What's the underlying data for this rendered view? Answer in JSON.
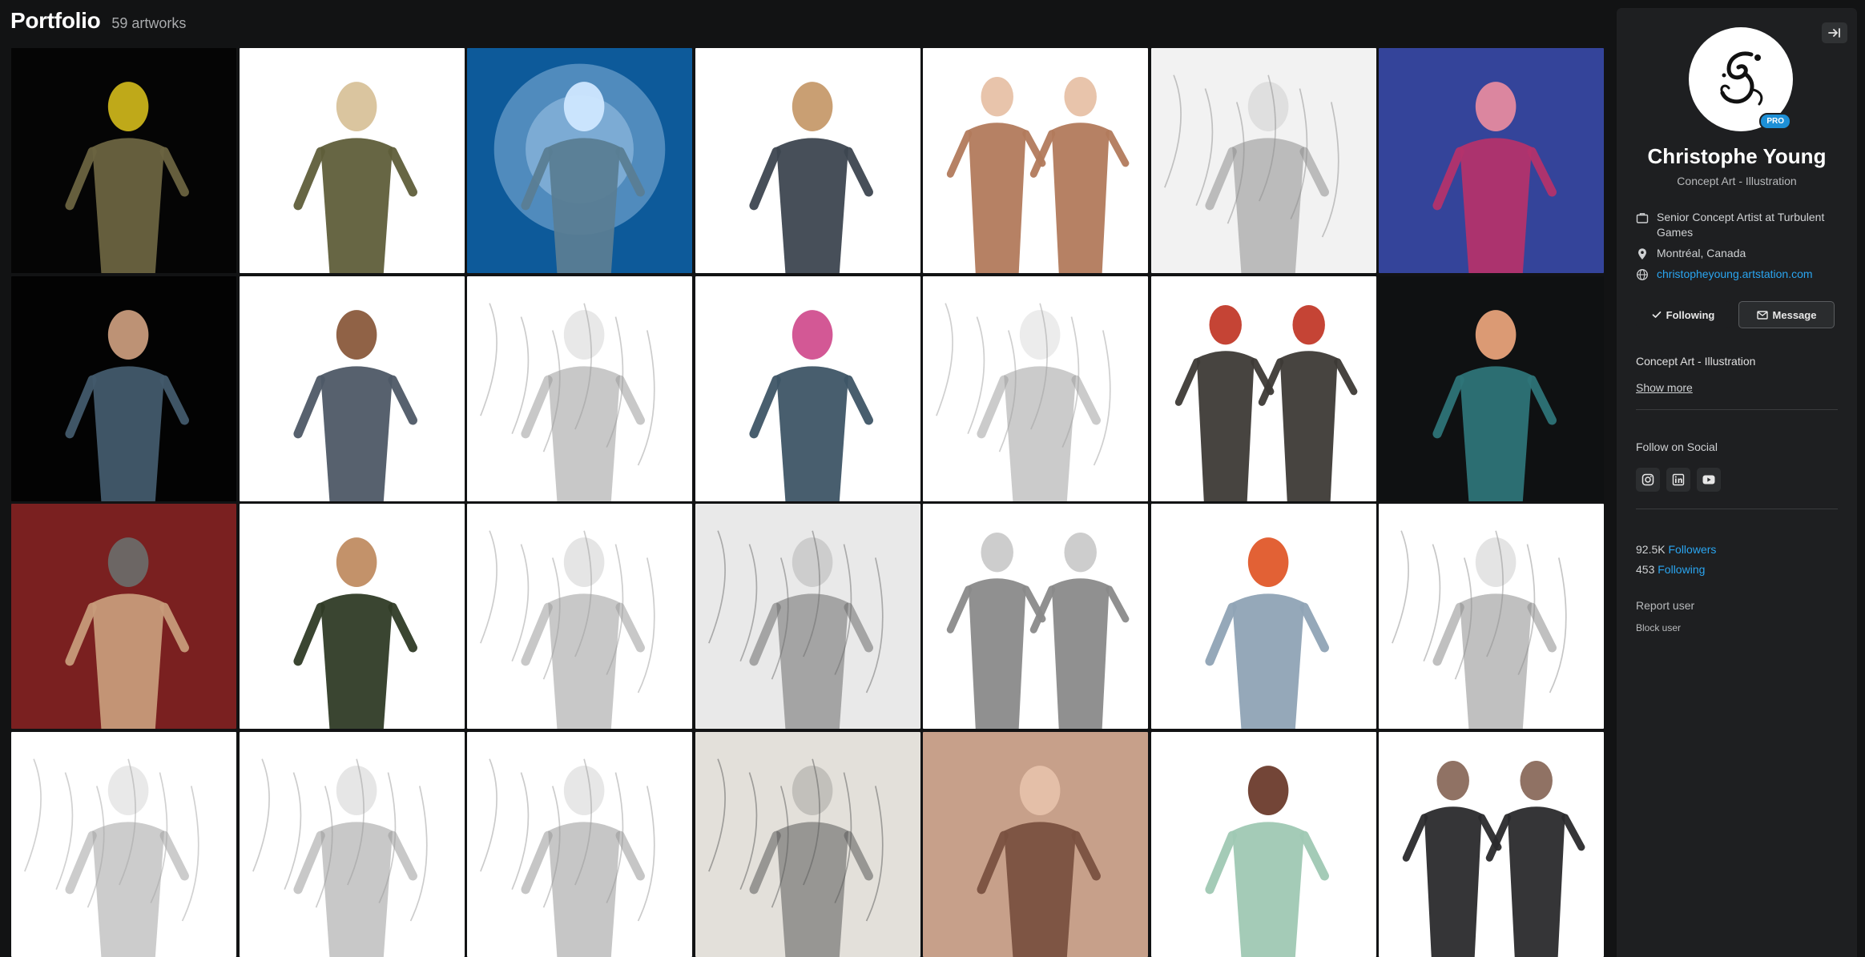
{
  "portfolio": {
    "title": "Portfolio",
    "count_label": "59 artworks"
  },
  "artworks": [
    {
      "alt": "artwork-1",
      "bg": "#050505",
      "fg": "#6a6340",
      "accent": "#c9b21a",
      "style": "figure"
    },
    {
      "alt": "artwork-2",
      "bg": "#ffffff",
      "fg": "#5f5e3a",
      "accent": "#d8c29a",
      "style": "figure"
    },
    {
      "alt": "artwork-3",
      "bg": "#0d5a9a",
      "fg": "#5a7d94",
      "accent": "#cfe7ff",
      "style": "glow"
    },
    {
      "alt": "artwork-4",
      "bg": "#ffffff",
      "fg": "#3d4650",
      "accent": "#c69a6c",
      "style": "figure"
    },
    {
      "alt": "artwork-5",
      "bg": "#ffffff",
      "fg": "#b27a5c",
      "accent": "#e7c1a6",
      "style": "pair"
    },
    {
      "alt": "artwork-6",
      "bg": "#f2f2f2",
      "fg": "#8e8e8e",
      "accent": "#cfcfcf",
      "style": "sketch"
    },
    {
      "alt": "artwork-7",
      "bg": "#34449a",
      "fg": "#b3336b",
      "accent": "#e58a9f",
      "style": "figure"
    },
    {
      "alt": "artwork-8",
      "bg": "#030303",
      "fg": "#425a6b",
      "accent": "#c79a7b",
      "style": "figure"
    },
    {
      "alt": "artwork-9",
      "bg": "#ffffff",
      "fg": "#4e5866",
      "accent": "#8a5a3c",
      "style": "figure"
    },
    {
      "alt": "artwork-10",
      "bg": "#ffffff",
      "fg": "#9a9a9a",
      "accent": "#d6d6d6",
      "style": "sketch"
    },
    {
      "alt": "artwork-11",
      "bg": "#ffffff",
      "fg": "#3e5566",
      "accent": "#d14f8f",
      "style": "figure"
    },
    {
      "alt": "artwork-12",
      "bg": "#ffffff",
      "fg": "#a0a0a0",
      "accent": "#dcdcdc",
      "style": "sketch"
    },
    {
      "alt": "artwork-13",
      "bg": "#ffffff",
      "fg": "#3d3a36",
      "accent": "#c23a2a",
      "style": "pair"
    },
    {
      "alt": "artwork-14",
      "bg": "#0f1112",
      "fg": "#2e7478",
      "accent": "#e7a27a",
      "style": "figure"
    },
    {
      "alt": "artwork-15",
      "bg": "#7a2020",
      "fg": "#c79b7a",
      "accent": "#6c6a68",
      "style": "figure"
    },
    {
      "alt": "artwork-16",
      "bg": "#ffffff",
      "fg": "#2f3b26",
      "accent": "#c08c62",
      "style": "figure"
    },
    {
      "alt": "artwork-17",
      "bg": "#ffffff",
      "fg": "#9b9b9b",
      "accent": "#d0d0d0",
      "style": "sketch"
    },
    {
      "alt": "artwork-18",
      "bg": "#e9e9e9",
      "fg": "#6b6b6b",
      "accent": "#b7b7b7",
      "style": "sketch"
    },
    {
      "alt": "artwork-19",
      "bg": "#ffffff",
      "fg": "#8a8a8a",
      "accent": "#cacaca",
      "style": "pair"
    },
    {
      "alt": "artwork-20",
      "bg": "#ffffff",
      "fg": "#8fa3b5",
      "accent": "#e0592a",
      "style": "figure"
    },
    {
      "alt": "artwork-21",
      "bg": "#ffffff",
      "fg": "#8d8d8d",
      "accent": "#cdcdcd",
      "style": "sketch"
    },
    {
      "alt": "artwork-22",
      "bg": "#ffffff",
      "fg": "#a3a3a3",
      "accent": "#d7d7d7",
      "style": "sketch"
    },
    {
      "alt": "artwork-23",
      "bg": "#ffffff",
      "fg": "#9a9a9a",
      "accent": "#d2d2d2",
      "style": "sketch"
    },
    {
      "alt": "artwork-24",
      "bg": "#ffffff",
      "fg": "#979797",
      "accent": "#d4d4d4",
      "style": "sketch"
    },
    {
      "alt": "artwork-25",
      "bg": "#e3e0da",
      "fg": "#5a5a5a",
      "accent": "#a8a6a2",
      "style": "sketch"
    },
    {
      "alt": "artwork-26",
      "bg": "#c7a08a",
      "fg": "#7a5140",
      "accent": "#e6c1aa",
      "style": "figure"
    },
    {
      "alt": "artwork-27",
      "bg": "#ffffff",
      "fg": "#9fc8b3",
      "accent": "#6b3b2c",
      "style": "figure"
    },
    {
      "alt": "artwork-28",
      "bg": "#ffffff",
      "fg": "#2a2a2c",
      "accent": "#8a6a5c",
      "style": "pair"
    }
  ],
  "profile": {
    "name": "Christophe Young",
    "headline": "Concept Art - Illustration",
    "pro_badge": "PRO",
    "job": "Senior Concept Artist at Turbulent Games",
    "location": "Montréal, Canada",
    "website": "christopheyoung.artstation.com",
    "following_button": "Following",
    "message_button": "Message",
    "about": "Concept Art - Illustration",
    "show_more": "Show more",
    "follow_on_social": "Follow on Social",
    "followers_count": "92.5K",
    "followers_label": "Followers",
    "following_count": "453",
    "following_label": "Following",
    "report_user": "Report user",
    "block_user": "Block user"
  },
  "icons": {
    "collapse": "collapse-panel-icon",
    "job": "briefcase-icon",
    "location": "map-pin-icon",
    "website": "globe-icon",
    "following": "checkmark-icon",
    "message": "envelope-icon",
    "social": [
      "instagram-icon",
      "linkedin-icon",
      "youtube-icon"
    ]
  },
  "colors": {
    "accent": "#2aa5f0",
    "pro_badge": "#1d8fd6",
    "page_bg": "#121314",
    "sidebar_bg": "#1e1f21"
  }
}
